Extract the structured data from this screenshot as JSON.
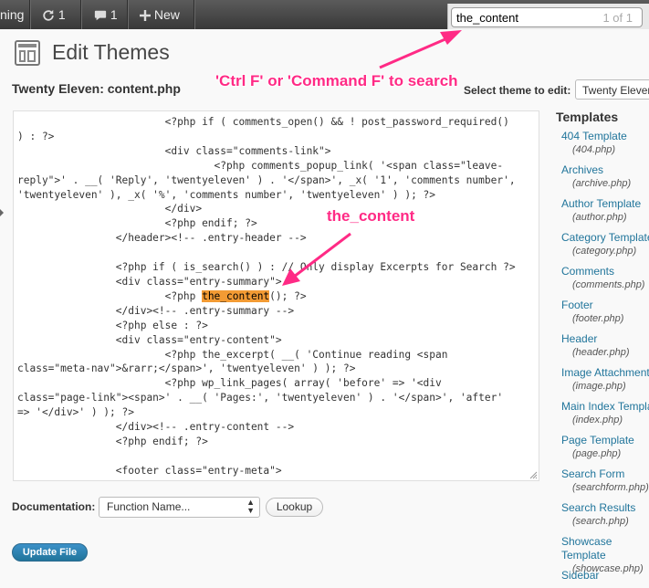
{
  "adminbar": {
    "site_fragment": "ning",
    "updates_count": "1",
    "comments_count": "1",
    "new_label": "New"
  },
  "findbar": {
    "query": "the_content",
    "match_count": "1 of 1"
  },
  "header": {
    "page_title": "Edit Themes",
    "file_title": "Twenty Eleven: content.php",
    "select_theme_label": "Select theme to edit:",
    "selected_theme": "Twenty Eleven"
  },
  "editor": {
    "lines": [
      "\t\t\t<?php if ( comments_open() && ! post_password_required()",
      ") : ?>",
      "\t\t\t<div class=\"comments-link\">",
      "\t\t\t\t<?php comments_popup_link( '<span class=\"leave-",
      "reply\">' . __( 'Reply', 'twentyeleven' ) . '</span>', _x( '1', 'comments number',",
      "'twentyeleven' ), _x( '%', 'comments number', 'twentyeleven' ) ); ?>",
      "\t\t\t</div>",
      "\t\t\t<?php endif; ?>",
      "\t\t</header><!-- .entry-header -->",
      "",
      "\t\t<?php if ( is_search() ) : // Only display Excerpts for Search ?>",
      "\t\t<div class=\"entry-summary\">",
      "\t\t\t<?php |the_content|(); ?>",
      "\t\t</div><!-- .entry-summary -->",
      "\t\t<?php else : ?>",
      "\t\t<div class=\"entry-content\">",
      "\t\t\t<?php the_excerpt( __( 'Continue reading <span",
      "class=\"meta-nav\">&rarr;</span>', 'twentyeleven' ) ); ?>",
      "\t\t\t<?php wp_link_pages( array( 'before' => '<div",
      "class=\"page-link\"><span>' . __( 'Pages:', 'twentyeleven' ) . '</span>', 'after'",
      "=> '</div>' ) ); ?>",
      "\t\t</div><!-- .entry-content -->",
      "\t\t<?php endif; ?>",
      "",
      "\t\t<footer class=\"entry-meta\">"
    ]
  },
  "annotations": {
    "search_tip": "'Ctrl F' or 'Command F' to search",
    "content_tip": "the_content"
  },
  "sidebar": {
    "heading": "Templates",
    "items": [
      {
        "name": "404 Template",
        "file": "(404.php)"
      },
      {
        "name": "Archives",
        "file": "(archive.php)"
      },
      {
        "name": "Author Template",
        "file": "(author.php)"
      },
      {
        "name": "Category Template",
        "file": "(category.php)"
      },
      {
        "name": "Comments",
        "file": "(comments.php)"
      },
      {
        "name": "Footer",
        "file": "(footer.php)"
      },
      {
        "name": "Header",
        "file": "(header.php)"
      },
      {
        "name": "Image Attachment",
        "file": "(image.php)"
      },
      {
        "name": "Main Index Template",
        "file": "(index.php)"
      },
      {
        "name": "Page Template",
        "file": "(page.php)"
      },
      {
        "name": "Search Form",
        "file": "(searchform.php)"
      },
      {
        "name": "Search Results",
        "file": "(search.php)"
      },
      {
        "name": "Showcase Template",
        "file": "(showcase.php)"
      },
      {
        "name": "Sidebar",
        "file": ""
      }
    ]
  },
  "footer": {
    "documentation_label": "Documentation:",
    "function_placeholder": "Function Name...",
    "lookup_label": "Lookup",
    "update_label": "Update File"
  },
  "colors": {
    "link": "#21759b",
    "annotation": "#ff2a85",
    "highlight": "#f39b34",
    "adminbar": "#464646",
    "primary_button": "#21759b"
  }
}
